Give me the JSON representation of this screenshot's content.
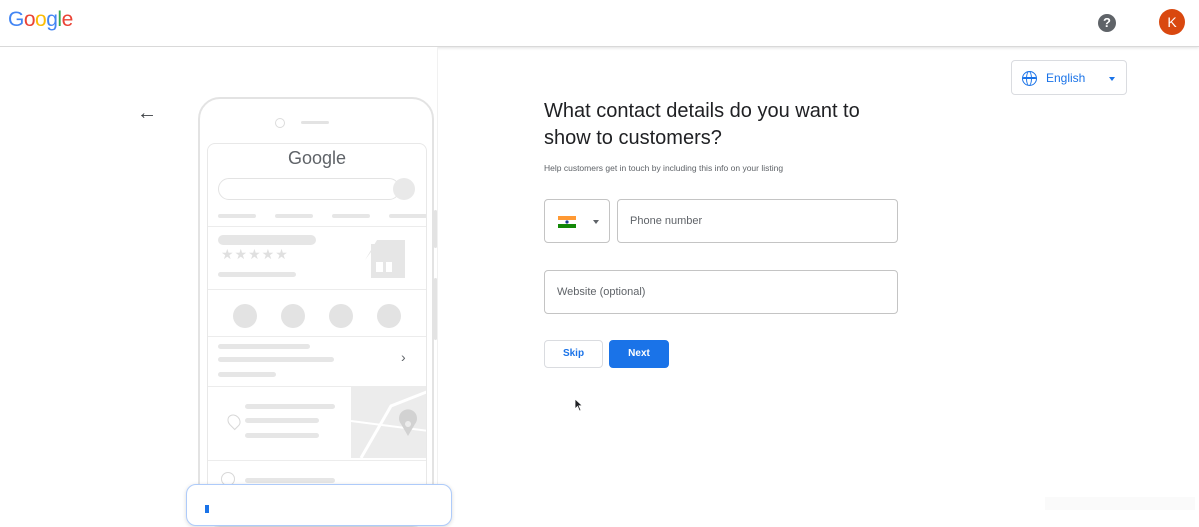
{
  "header": {
    "logo_text": "Google",
    "logo_colors": [
      "#4285F4",
      "#EA4335",
      "#FBBC05",
      "#4285F4",
      "#34A853",
      "#EA4335"
    ],
    "help_icon": "?",
    "avatar_initial": "K",
    "avatar_color": "#d9480f"
  },
  "illustration": {
    "brand": "Google",
    "chevron": "›",
    "stars": "★★★★★"
  },
  "language": {
    "label": "English"
  },
  "form": {
    "heading": "What contact details do you want to show to customers?",
    "subtext": "Help customers get in touch by including this info on your listing",
    "country_flag": "India flag",
    "phone_placeholder": "Phone number",
    "website_placeholder": "Website (optional)",
    "skip_label": "Skip",
    "next_label": "Next"
  },
  "colors": {
    "primary": "#1a73e8",
    "flag_saffron": "#FF9933",
    "flag_white": "#FFFFFF",
    "flag_green": "#138808"
  },
  "icons": {
    "back": "arrow-left-icon",
    "help": "help-icon",
    "language": "globe-icon",
    "dropdown": "caret-down-icon",
    "pointer": "mouse-cursor-icon"
  }
}
